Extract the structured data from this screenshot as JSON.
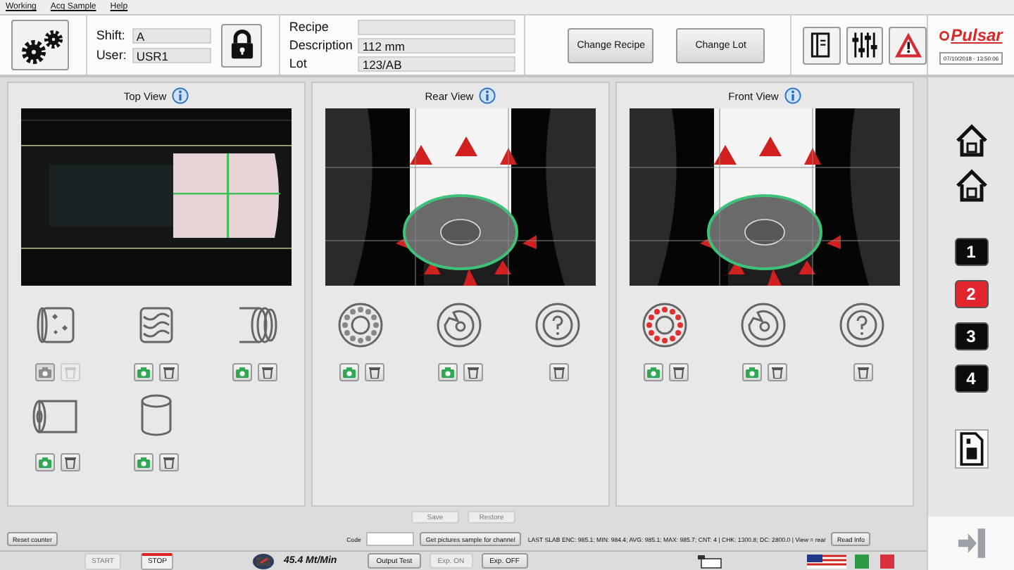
{
  "menu": [
    "Working",
    "Acq Sample",
    "Help"
  ],
  "header": {
    "shift_label": "Shift:",
    "shift": "A",
    "user_label": "User:",
    "user": "USR1",
    "recipe_label": "Recipe",
    "description_label": "Description",
    "description": "112 mm",
    "lot_label": "Lot",
    "lot": "123/AB",
    "buttons": [
      "Change Recipe",
      "Change Lot"
    ]
  },
  "brand": {
    "logo": "Pulsar",
    "datetime": "07/10/2018 - 13:50:06"
  },
  "views": [
    {
      "title": "Top View",
      "kind": "top",
      "defects": [
        {
          "kind": "spots",
          "camera_active": false,
          "trash_enabled": false
        },
        {
          "kind": "wrinkles",
          "camera_active": true,
          "trash_enabled": true
        },
        {
          "kind": "layers",
          "camera_active": true,
          "trash_enabled": true
        },
        {
          "kind": "roll",
          "camera_active": true,
          "trash_enabled": true
        },
        {
          "kind": "core",
          "camera_active": true,
          "trash_enabled": true
        }
      ]
    },
    {
      "title": "Rear View",
      "kind": "end",
      "defects": [
        {
          "kind": "ring-dots",
          "alert": false,
          "camera_active": true,
          "trash_enabled": true
        },
        {
          "kind": "notch",
          "camera_active": true,
          "trash_enabled": true
        },
        {
          "kind": "unknown",
          "trash_enabled": true
        }
      ]
    },
    {
      "title": "Front View",
      "kind": "end",
      "defects": [
        {
          "kind": "ring-dots",
          "alert": true,
          "camera_active": true,
          "trash_enabled": true
        },
        {
          "kind": "notch",
          "camera_active": true,
          "trash_enabled": true
        },
        {
          "kind": "unknown",
          "trash_enabled": true
        }
      ]
    }
  ],
  "actions": [
    {
      "label": "Save",
      "disabled": true
    },
    {
      "label": "Restore",
      "disabled": true
    }
  ],
  "bottom": {
    "reset": "Reset counter",
    "code_label": "Code",
    "get_pictures": "Get pictures sample for channel",
    "info": "LAST SLAB ENC: 985.1; MIN: 984.4; AVG: 985.1; MAX: 985.7; CNT: 4 | CHK: 1300.8; DC: 2800.0 | View = rear",
    "read_info": "Read Info"
  },
  "status": {
    "controls": [
      {
        "label": "START",
        "disabled": true
      },
      {
        "label": "STOP",
        "disabled": false
      }
    ],
    "speed": "45.4 Mt/Min",
    "buttons": [
      {
        "label": "Output Test",
        "disabled": false
      },
      {
        "label": "Exp. ON",
        "disabled": true
      },
      {
        "label": "Exp. OFF",
        "disabled": false
      }
    ]
  },
  "sidebar": {
    "channels": [
      {
        "label": "1",
        "selected": false
      },
      {
        "label": "2",
        "selected": true
      },
      {
        "label": "3",
        "selected": false
      },
      {
        "label": "4",
        "selected": false
      }
    ]
  }
}
